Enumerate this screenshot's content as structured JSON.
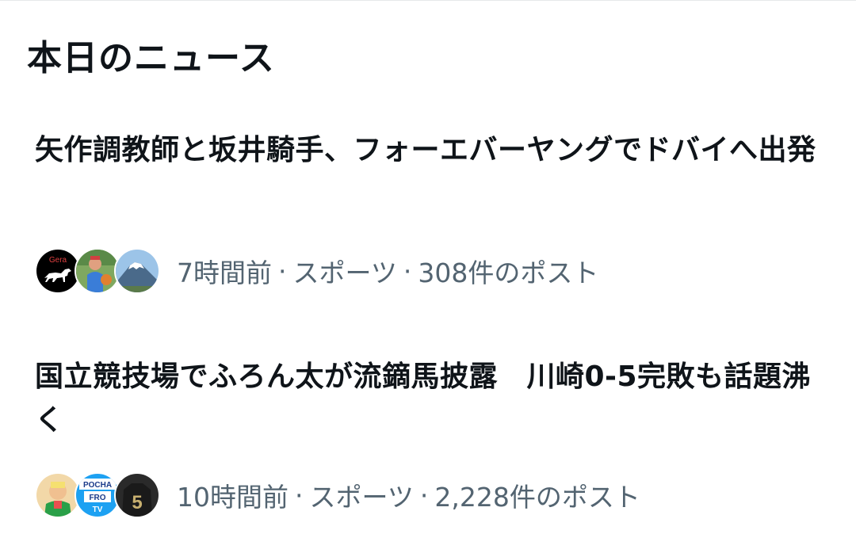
{
  "section": {
    "title": "本日のニュース"
  },
  "news": [
    {
      "headline": "矢作調教師と坂井騎手、フォーエバーヤングでドバイへ出発",
      "time": "7時間前",
      "category": "スポーツ",
      "posts": "308件のポスト",
      "separator": "·",
      "avatars": [
        {
          "icon": "horse-logo-avatar",
          "text": "Gera",
          "color": "#000000"
        },
        {
          "icon": "person-avatar",
          "color": "#3a7dd8"
        },
        {
          "icon": "mount-fuji-avatar",
          "color": "#6fa5d6"
        }
      ]
    },
    {
      "headline": "国立競技場でふろん太が流鏑馬披露　川崎0-5完敗も話題沸く",
      "time": "10時間前",
      "category": "スポーツ",
      "posts": "2,228件のポスト",
      "separator": "·",
      "avatars": [
        {
          "icon": "person-avatar",
          "color": "#f0b090"
        },
        {
          "icon": "channel-logo-avatar",
          "text_lines": [
            "POCHA",
            "FRO",
            "TV"
          ],
          "color": "#1da1f2"
        },
        {
          "icon": "jersey-avatar",
          "text": "5",
          "color": "#2a2a2a"
        }
      ]
    }
  ]
}
